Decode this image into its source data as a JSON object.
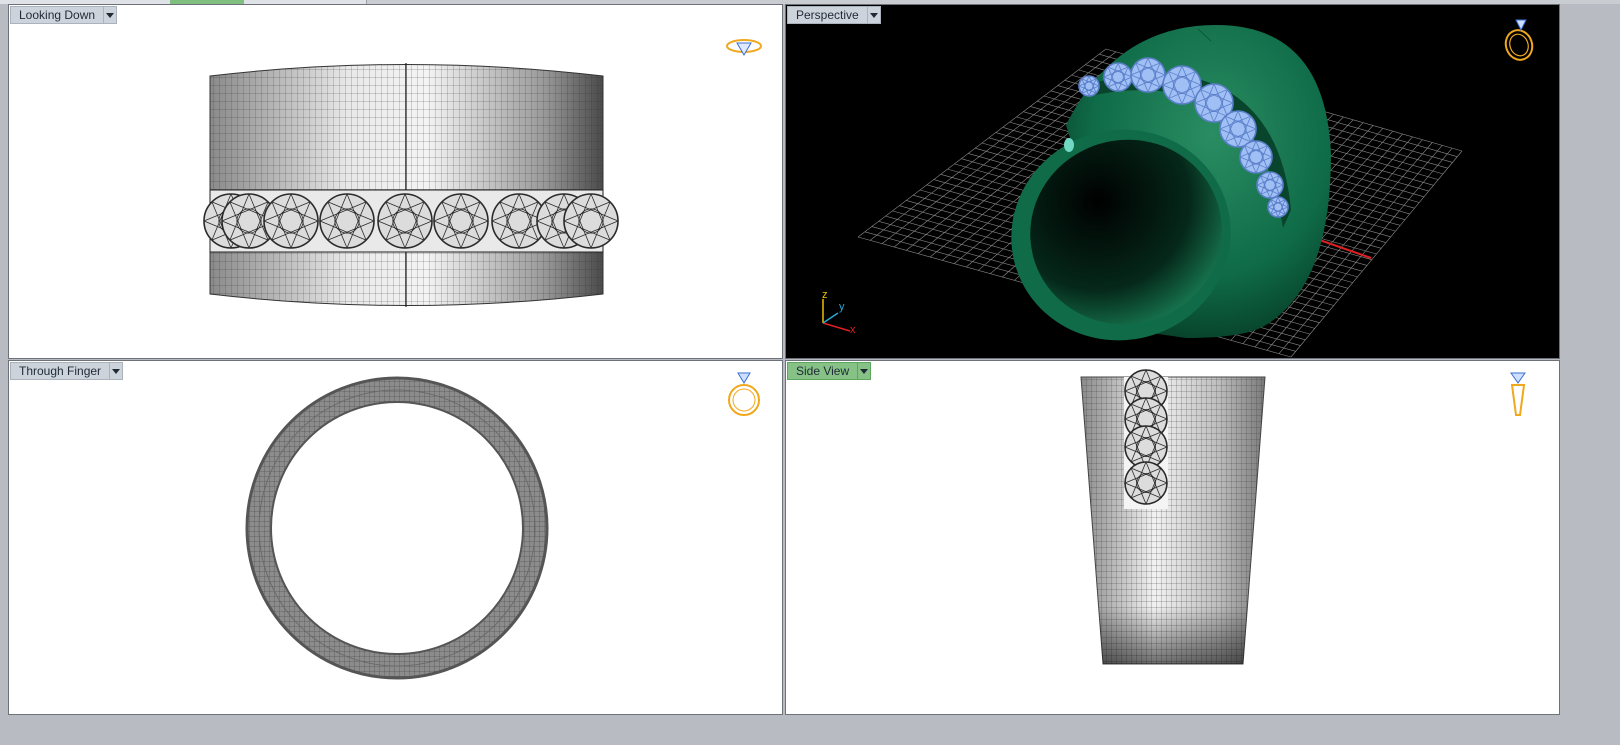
{
  "tabs": [
    {
      "state": "normal"
    },
    {
      "state": "active"
    },
    {
      "state": "normal"
    },
    {
      "state": "normal"
    }
  ],
  "viewports": {
    "top_left": {
      "label": "Looking Down",
      "active": false,
      "background": "#ffffff",
      "nav_icon": "ring-top-view-icon"
    },
    "top_right": {
      "label": "Perspective",
      "active": false,
      "background": "#000000",
      "nav_icon": "ring-perspective-view-icon",
      "axes": {
        "z": "z",
        "y": "y",
        "x": "x"
      }
    },
    "bottom_left": {
      "label": "Through Finger",
      "active": false,
      "background": "#ffffff",
      "nav_icon": "ring-front-view-icon"
    },
    "bottom_right": {
      "label": "Side View",
      "active": true,
      "background": "#ffffff",
      "nav_icon": "ring-side-view-icon"
    }
  },
  "colors": {
    "ring_green": "#0f6b48",
    "gem_blue": "#8fb4f5",
    "icon_orange": "#f0a81e",
    "active_label": "#86c286",
    "axis_x": "#e02020",
    "axis_y": "#2aa7d8"
  }
}
